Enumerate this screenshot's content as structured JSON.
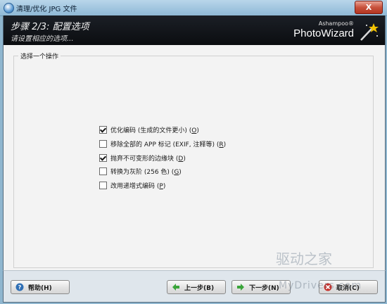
{
  "window": {
    "title": "清理/优化 JPG 文件",
    "close_glyph": "X"
  },
  "header": {
    "step_title": "步骤 2/3: 配置选项",
    "step_subtitle": "请设置相应的选项...",
    "brand_small": "Ashampoo®",
    "brand_big": "PhotoWizard"
  },
  "group": {
    "legend": "选择一个操作"
  },
  "options": [
    {
      "label": "优化编码 (生成的文件更小)",
      "key": "O",
      "checked": true
    },
    {
      "label": "移除全部的 APP 标记 (EXIF, 注释等)",
      "key": "R",
      "checked": false
    },
    {
      "label": "抛弃不可变形的边缘块",
      "key": "D",
      "checked": true
    },
    {
      "label": "转换为灰阶 (256 色)",
      "key": "G",
      "checked": false
    },
    {
      "label": "改用递增式编码",
      "key": "P",
      "checked": false
    }
  ],
  "buttons": {
    "help": "帮助(H)",
    "back": "上一步(B)",
    "next": "下一步(N)",
    "cancel": "取消(C)"
  },
  "watermark": {
    "line1": "驱动之家",
    "line2": "MyDrivers.com"
  },
  "colors": {
    "banner": "#0b0d10",
    "panel": "#f3f3f3",
    "close": "#c8523c",
    "arrow_green": "#3aa53a"
  }
}
